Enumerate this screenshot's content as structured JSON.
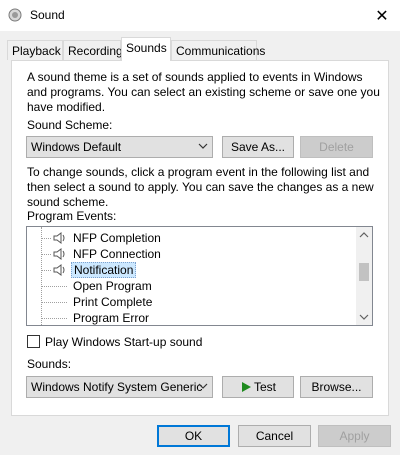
{
  "window": {
    "title": "Sound",
    "close_glyph": "✕"
  },
  "tabs": [
    {
      "label": "Playback"
    },
    {
      "label": "Recording"
    },
    {
      "label": "Sounds",
      "active": true
    },
    {
      "label": "Communications"
    }
  ],
  "intro": {
    "line1": "A sound theme is a set of sounds applied to events in Windows",
    "line2": "and programs.  You can select an existing scheme or save one you",
    "line3": "have modified."
  },
  "scheme": {
    "label": "Sound Scheme:",
    "value": "Windows Default",
    "save_as": "Save As...",
    "delete": "Delete"
  },
  "instructions": {
    "line1": "To change sounds, click a program event in the following list and",
    "line2": "then select a sound to apply.  You can save the changes as a new",
    "line3": "sound scheme."
  },
  "events": {
    "label": "Program Events:",
    "items": [
      {
        "label": "NFP Completion",
        "has_sound": true
      },
      {
        "label": "NFP Connection",
        "has_sound": true
      },
      {
        "label": "Notification",
        "has_sound": true,
        "selected": true
      },
      {
        "label": "Open Program",
        "has_sound": false
      },
      {
        "label": "Print Complete",
        "has_sound": false
      },
      {
        "label": "Program Error",
        "has_sound": false
      }
    ]
  },
  "startup": {
    "label": "Play Windows Start-up sound",
    "checked": false
  },
  "sounds": {
    "label": "Sounds:",
    "value": "Windows Notify System Generic",
    "test": "Test",
    "browse": "Browse..."
  },
  "footer": {
    "ok": "OK",
    "cancel": "Cancel",
    "apply": "Apply"
  },
  "colors": {
    "accent": "#0078d7",
    "selection": "#cce8ff",
    "play_icon": "#1e8a1e"
  }
}
